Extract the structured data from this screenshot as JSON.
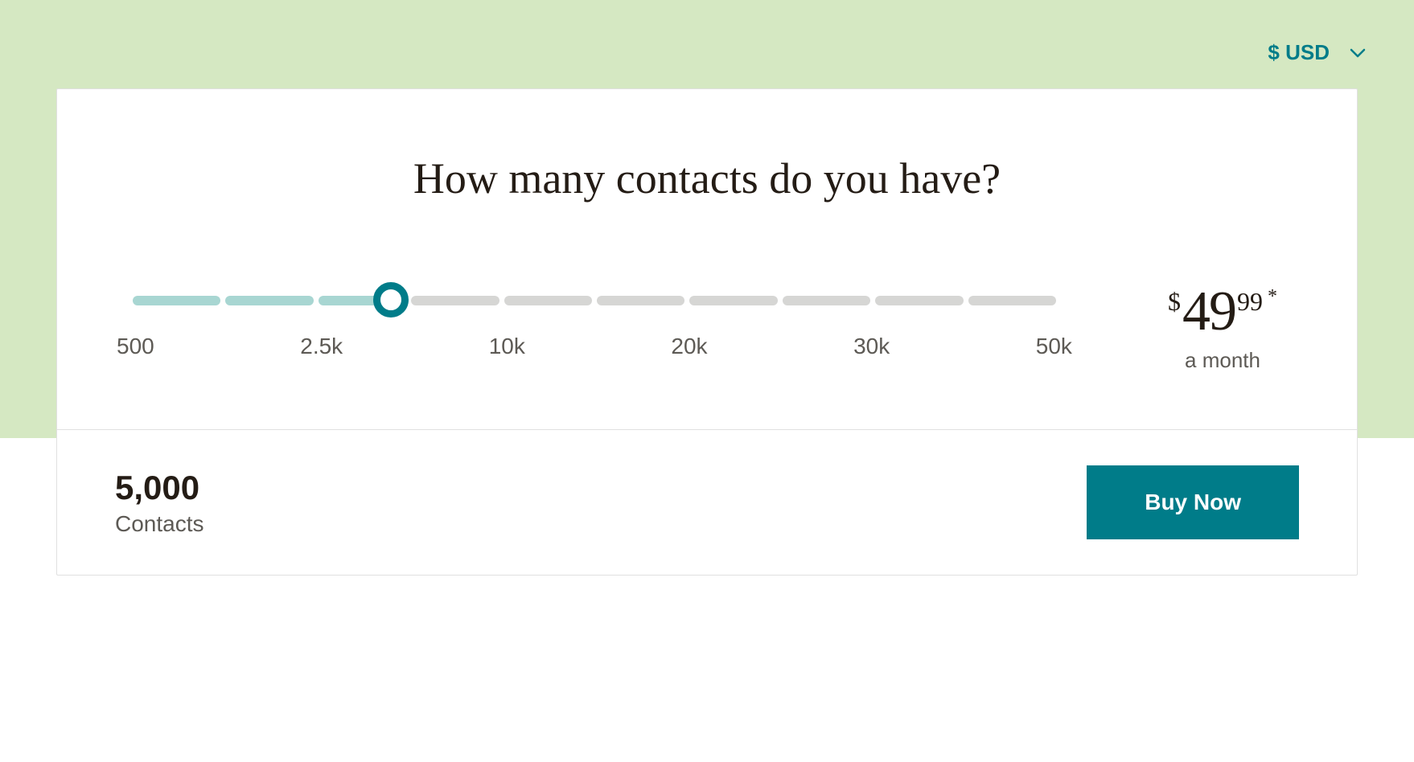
{
  "currency": {
    "label": "$ USD"
  },
  "heading": "How many contacts do you have?",
  "slider": {
    "segments_total": 10,
    "segments_filled": 3,
    "thumb_position_percent": 28.0,
    "labels": [
      "500",
      "2.5k",
      "10k",
      "20k",
      "30k",
      "50k"
    ]
  },
  "price": {
    "currency_symbol": "$",
    "whole": "49",
    "cents": "99",
    "asterisk": "*",
    "period": "a month"
  },
  "summary": {
    "count": "5,000",
    "label": "Contacts"
  },
  "cta": {
    "buy_label": "Buy Now"
  }
}
